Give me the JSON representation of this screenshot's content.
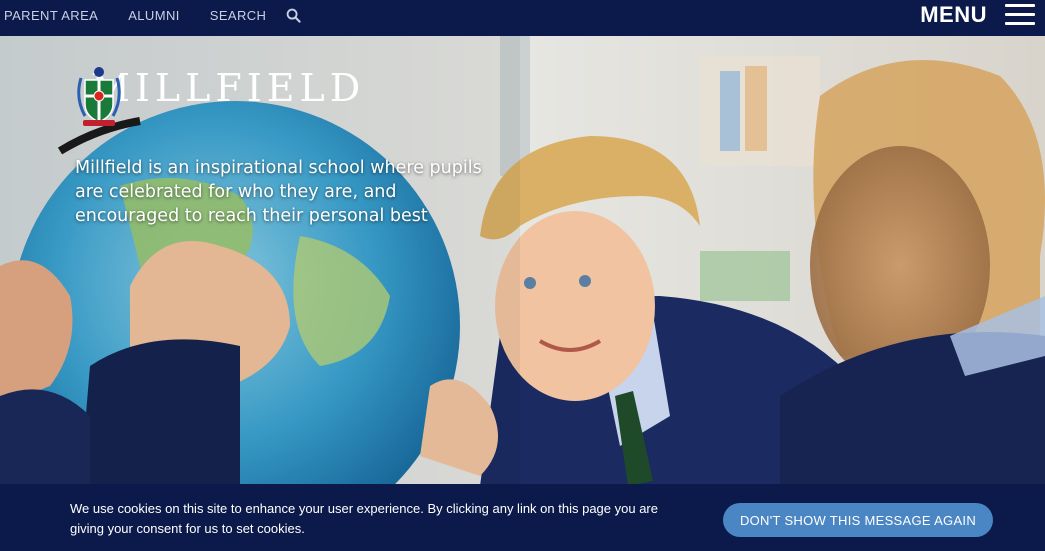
{
  "topbar": {
    "links": [
      "PARENT AREA",
      "ALUMNI",
      "SEARCH"
    ],
    "search_icon": "search-icon",
    "menu_label": "MENU",
    "menu_icon": "hamburger-icon"
  },
  "hero": {
    "brand_name": "MILLFIELD",
    "crest_icon": "school-crest-icon",
    "tagline": "Millfield is an inspirational school where pupils are celebrated for who they are, and encouraged to reach their personal best"
  },
  "cookie": {
    "message": "We use cookies on this site to enhance your user experience. By clicking any link on this page you are giving your consent for us to set cookies.",
    "button_label": "DON'T SHOW THIS MESSAGE AGAIN"
  },
  "colors": {
    "navy": "#0b1a4a",
    "button_blue": "#4b86c4"
  }
}
